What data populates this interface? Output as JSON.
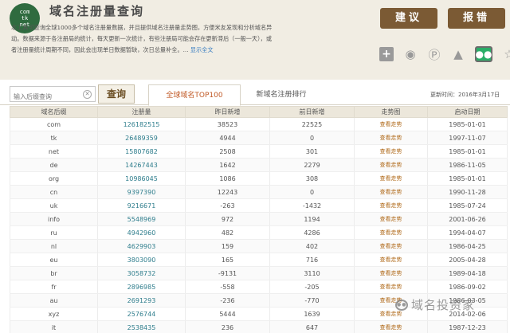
{
  "header": {
    "logo_lines": [
      "com",
      "tk",
      "net"
    ],
    "title": "域名注册量查询",
    "description": "本工具可查询全球1000多个域名注册量数据，并且提供域名注册量走势图，方便米友发现和分析域名异动。数据来源于各注册局的统计，每天更新一次统计，有些注册局可能会存在更新滞后（一般一天），或者注册量统计周期不同，因此会出现单日数据暂缺，次日总量补全。...",
    "more_link": "显示全文",
    "suggest_btn": "建议",
    "report_btn": "报错"
  },
  "share": {
    "icons": [
      "plus-icon",
      "weibo-icon",
      "pinterest-icon",
      "hat-icon",
      "wechat-icon",
      "star-icon"
    ]
  },
  "toolbar": {
    "search_placeholder": "输入后缀查询",
    "search_btn": "查询",
    "tab_active": "全球域名TOP100",
    "tab_2": "新域名注册排行",
    "update_time": "更新时间：2016年3月17日"
  },
  "table": {
    "headers": [
      "域名后缀",
      "注册量",
      "昨日新增",
      "前日新增",
      "走势图",
      "启动日期"
    ],
    "rows": [
      [
        "com",
        "126182515",
        "38523",
        "22525",
        "查看走势",
        "1985-01-01"
      ],
      [
        "tk",
        "26489359",
        "4944",
        "0",
        "查看走势",
        "1997-11-07"
      ],
      [
        "net",
        "15807682",
        "2508",
        "301",
        "查看走势",
        "1985-01-01"
      ],
      [
        "de",
        "14267443",
        "1642",
        "2279",
        "查看走势",
        "1986-11-05"
      ],
      [
        "org",
        "10986045",
        "1086",
        "308",
        "查看走势",
        "1985-01-01"
      ],
      [
        "cn",
        "9397390",
        "12243",
        "0",
        "查看走势",
        "1990-11-28"
      ],
      [
        "uk",
        "9216671",
        "-263",
        "-1432",
        "查看走势",
        "1985-07-24"
      ],
      [
        "info",
        "5548969",
        "972",
        "1194",
        "查看走势",
        "2001-06-26"
      ],
      [
        "ru",
        "4942960",
        "482",
        "4286",
        "查看走势",
        "1994-04-07"
      ],
      [
        "nl",
        "4629903",
        "159",
        "402",
        "查看走势",
        "1986-04-25"
      ],
      [
        "eu",
        "3803090",
        "165",
        "716",
        "查看走势",
        "2005-04-28"
      ],
      [
        "br",
        "3058732",
        "-9131",
        "3110",
        "查看走势",
        "1989-04-18"
      ],
      [
        "fr",
        "2896985",
        "-558",
        "-205",
        "查看走势",
        "1986-09-02"
      ],
      [
        "au",
        "2691293",
        "-236",
        "-770",
        "查看走势",
        "1986-03-05"
      ],
      [
        "xyz",
        "2576744",
        "5444",
        "1639",
        "查看走势",
        "2014-02-06"
      ],
      [
        "it",
        "2538435",
        "236",
        "647",
        "查看走势",
        "1987-12-23"
      ]
    ]
  },
  "watermark": "域名投资家"
}
